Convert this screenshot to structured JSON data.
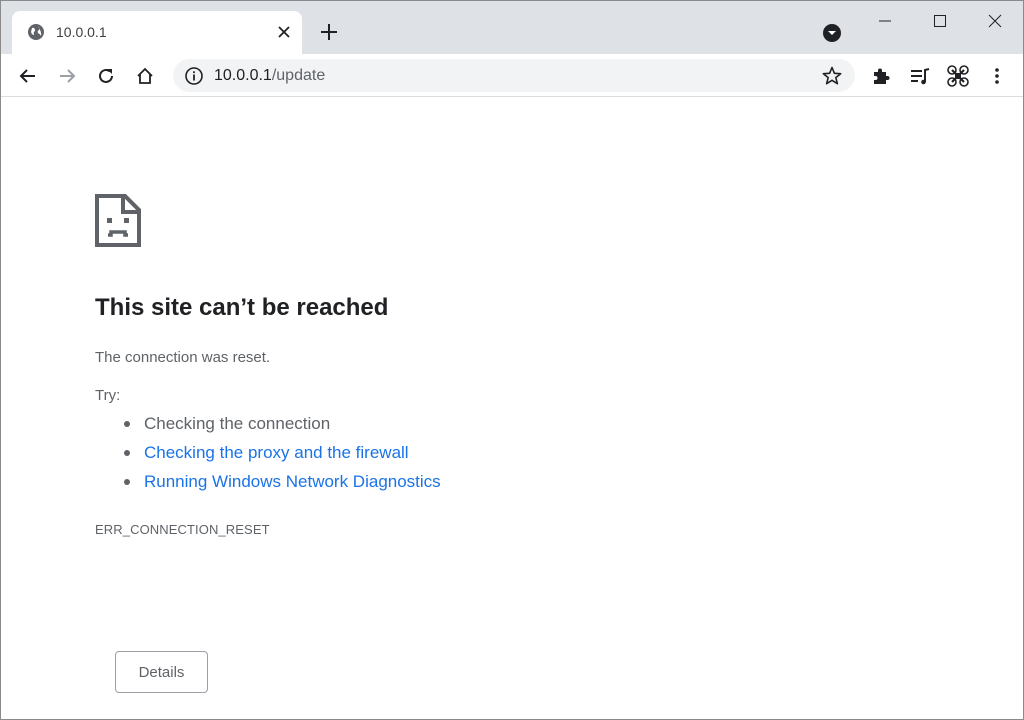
{
  "tab": {
    "title": "10.0.0.1",
    "favicon": "globe-icon",
    "close_icon": "close-icon"
  },
  "newtab_icon": "plus-icon",
  "window_controls": [
    "minimize-icon",
    "maximize-icon",
    "close-icon"
  ],
  "toolbar": {
    "back_icon": "back-arrow-icon",
    "forward_icon": "forward-arrow-icon",
    "reload_icon": "reload-icon",
    "home_icon": "home-icon",
    "extensions_icon": "puzzle-icon",
    "media_icon": "media-queue-icon",
    "extension2_icon": "drone-extension-icon",
    "menu_icon": "kebab-menu-icon"
  },
  "omnibox": {
    "host": "10.0.0.1",
    "path": "/update",
    "info_icon": "info-icon",
    "star_icon": "star-icon"
  },
  "error": {
    "icon": "sad-document-icon",
    "title": "This site can’t be reached",
    "message": "The connection was reset.",
    "try_label": "Try:",
    "suggestions": [
      {
        "text": "Checking the connection",
        "is_link": false
      },
      {
        "text": "Checking the proxy and the firewall",
        "is_link": true
      },
      {
        "text": "Running Windows Network Diagnostics",
        "is_link": true
      }
    ],
    "code": "ERR_CONNECTION_RESET",
    "details_button": "Details"
  },
  "colors": {
    "tabstrip_bg": "#dee1e6",
    "omnibox_bg": "#f1f3f4",
    "title_text": "#202124",
    "secondary_text": "#5f6368",
    "link": "#1a73e8"
  }
}
